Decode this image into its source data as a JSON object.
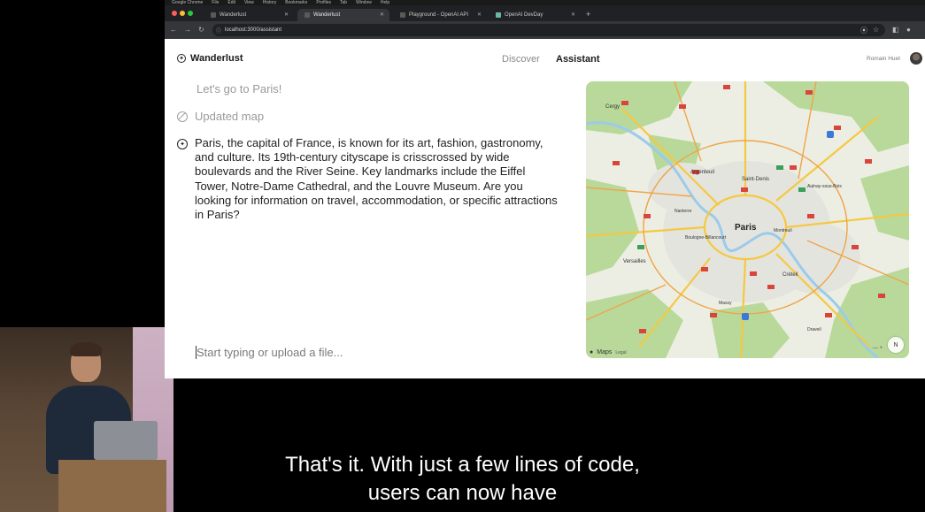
{
  "browser": {
    "menubar": [
      "Google Chrome",
      "File",
      "Edit",
      "View",
      "History",
      "Bookmarks",
      "Profiles",
      "Tab",
      "Window",
      "Help"
    ],
    "tabs": [
      {
        "label": "Wanderlust",
        "active": false
      },
      {
        "label": "Wanderlust",
        "active": true
      },
      {
        "label": "Playground - OpenAI API",
        "active": false
      },
      {
        "label": "OpenAI DevDay",
        "active": false
      }
    ],
    "url": "localhost:3000/assistant"
  },
  "app": {
    "brand": "Wanderlust",
    "nav": {
      "discover": "Discover",
      "assistant": "Assistant"
    },
    "user": {
      "name": "Romain Huet"
    }
  },
  "chat": {
    "user_message": "Let's go to Paris!",
    "tool_status": "Updated map",
    "assistant_message": "Paris, the capital of France, is known for its art, fashion, gastronomy, and culture. Its 19th-century cityscape is crisscrossed by wide boulevards and the River Seine. Key landmarks include the Eiffel Tower, Notre-Dame Cathedral, and the Louvre Museum. Are you looking for information on travel, accommodation, or specific attractions in Paris?",
    "composer_placeholder": "Start typing or upload a file..."
  },
  "map": {
    "center_label": "Paris",
    "places": [
      "Cergy",
      "Argenteuil",
      "Saint-Denis",
      "Aulnay-sous-Bois",
      "Boulogne-Billancourt",
      "Versailles",
      "Créteil",
      "Montreuil",
      "Nanterre",
      "Massy",
      "Draveil"
    ],
    "attribution": "Maps",
    "legal": "Legal",
    "compass": "N"
  },
  "captions": [
    "That's it. With just a few lines of code,",
    "users can now have"
  ],
  "colors": {
    "map_green": "#b8d99a",
    "map_urban": "#e9e9e3",
    "road_yellow": "#f5c842",
    "road_orange": "#f0a447",
    "marker_red": "#d9453b"
  }
}
